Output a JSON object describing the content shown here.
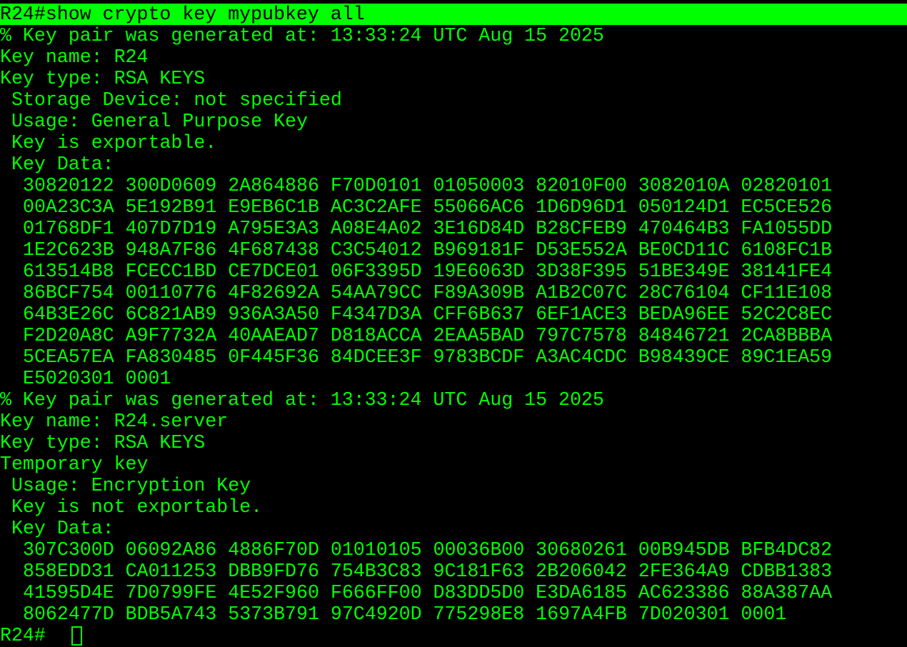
{
  "terminal": {
    "command_line": "R24#show crypto key mypubkey all",
    "prompt": "R24#",
    "colors": {
      "background": "#000000",
      "text": "#00ff00",
      "command_highlight_bg": "#00ff00",
      "command_highlight_fg": "#000000"
    }
  },
  "key1": {
    "generated": "% Key pair was generated at: 13:33:24 UTC Aug 15 2025",
    "name": "Key name: R24",
    "type": "Key type: RSA KEYS",
    "storage": "Storage Device: not specified",
    "usage": "Usage: General Purpose Key",
    "exportable": "Key is exportable.",
    "data_label": "Key Data:",
    "data_lines": [
      "30820122 300D0609 2A864886 F70D0101 01050003 82010F00 3082010A 02820101",
      "00A23C3A 5E192B91 E9EB6C1B AC3C2AFE 55066AC6 1D6D96D1 050124D1 EC5CE526",
      "01768DF1 407D7D19 A795E3A3 A08E4A02 3E16D84D B28CFEB9 470464B3 FA1055DD",
      "1E2C623B 948A7F86 4F687438 C3C54012 B969181F D53E552A BE0CD11C 6108FC1B",
      "613514B8 FCECC1BD CE7DCE01 06F3395D 19E6063D 3D38F395 51BE349E 38141FE4",
      "86BCF754 00110776 4F82692A 54AA79CC F89A309B A1B2C07C 28C76104 CF11E108",
      "64B3E26C 6C821AB9 936A3A50 F4347D3A CFF6B637 6EF1ACE3 BEDA96EE 52C2C8EC",
      "F2D20A8C A9F7732A 40AAEAD7 D818ACCA 2EAA5BAD 797C7578 84846721 2CA8BBBA",
      "5CEA57EA FA830485 0F445F36 84DCEE3F 9783BCDF A3AC4CDC B98439CE 89C1EA59",
      "E5020301 0001"
    ]
  },
  "key2": {
    "generated": "% Key pair was generated at: 13:33:24 UTC Aug 15 2025",
    "name": "Key name: R24.server",
    "type": "Key type: RSA KEYS",
    "temporary": "Temporary key",
    "usage": "Usage: Encryption Key",
    "exportable": "Key is not exportable.",
    "data_label": "Key Data:",
    "data_lines": [
      "307C300D 06092A86 4886F70D 01010105 00036B00 30680261 00B945DB BFB4DC82",
      "858EDD31 CA011253 DBB9FD76 754B3C83 9C181F63 2B206042 2FE364A9 CDBB1383",
      "41595D4E 7D0799FE 4E52F960 F666FF00 D83DD5D0 E3DA6185 AC623386 88A387AA",
      "8062477D BDB5A743 5373B791 97C4920D 775298E8 1697A4FB 7D020301 0001"
    ]
  }
}
